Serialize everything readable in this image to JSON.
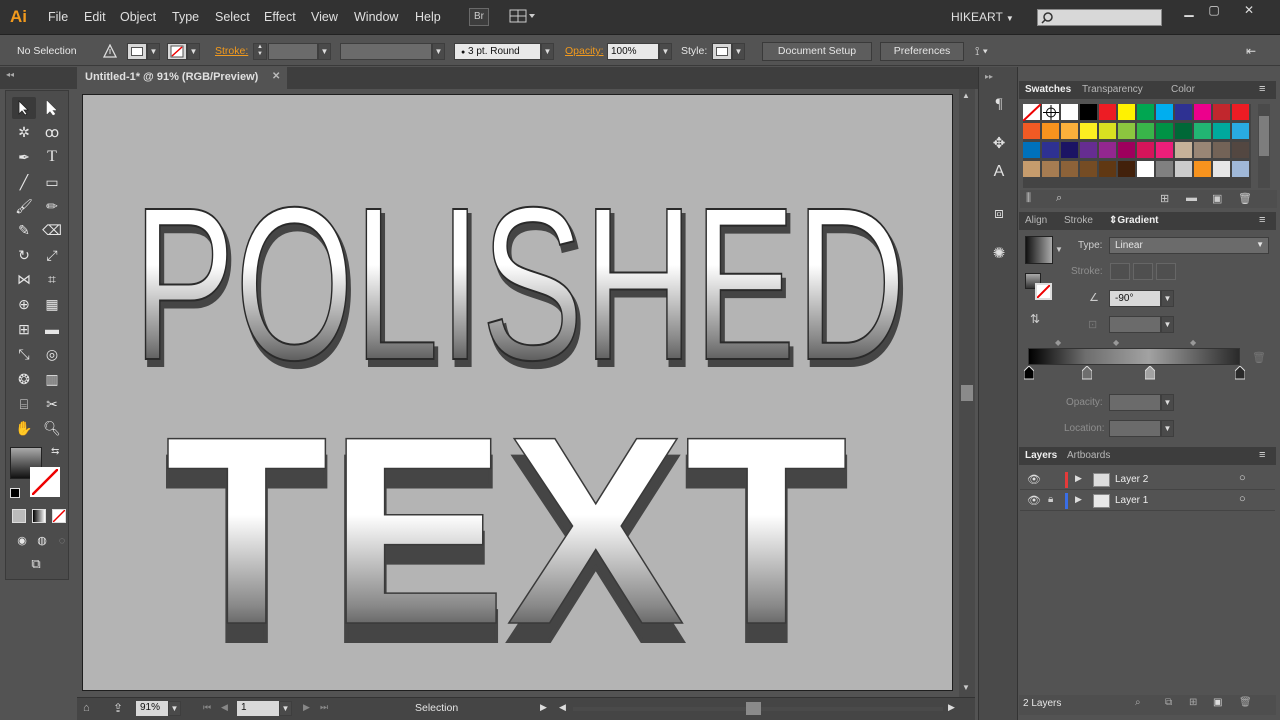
{
  "app": {
    "logo": "Ai",
    "workspace": "HIKEART",
    "bridge_label": "Br"
  },
  "menu": [
    "File",
    "Edit",
    "Object",
    "Type",
    "Select",
    "Effect",
    "View",
    "Window",
    "Help"
  ],
  "control_bar": {
    "selection_status": "No Selection",
    "stroke_label": "Stroke:",
    "brush_value": "3 pt. Round",
    "opacity_label": "Opacity:",
    "opacity_value": "100%",
    "style_label": "Style:",
    "document_setup": "Document Setup",
    "preferences": "Preferences"
  },
  "document": {
    "tab_title": "Untitled-1* @ 91% (RGB/Preview)"
  },
  "artwork": {
    "line1": "POLISHED",
    "line2": "TEXT"
  },
  "status_bar": {
    "zoom": "91%",
    "artboard_number": "1",
    "tool": "Selection"
  },
  "swatches_panel": {
    "tabs": [
      "Swatches",
      "Transparency",
      "Color"
    ],
    "rows": [
      [
        "none",
        "registration",
        "#ffffff",
        "#000000",
        "#ed1c24",
        "#fff200",
        "#00a651",
        "#00aeef",
        "#2e3192",
        "#ec008c",
        "#c1272d",
        "#ed1c24"
      ],
      [
        "#f15a24",
        "#f7931e",
        "#fbb03b",
        "#fcee21",
        "#d9e021",
        "#8cc63f",
        "#39b54a",
        "#009245",
        "#006837",
        "#22b573",
        "#00a99d",
        "#29abe2"
      ],
      [
        "#0071bc",
        "#2e3192",
        "#1b1464",
        "#662d91",
        "#93278f",
        "#9e005d",
        "#d4145a",
        "#ed1e79",
        "#c7b299",
        "#998675",
        "#736357",
        "#534741"
      ],
      [
        "#c69c6d",
        "#a67c52",
        "#8c6239",
        "#754c24",
        "#603813",
        "#42210b",
        "#ffffff",
        "#808080",
        "#cccccc",
        "#f7931e",
        "#e6e6e6",
        "#a0b8d8"
      ]
    ]
  },
  "gradient_panel": {
    "tabs": [
      "Align",
      "Stroke",
      "Gradient"
    ],
    "type_label": "Type:",
    "type_value": "Linear",
    "stroke_label": "Stroke:",
    "angle_value": "-90°",
    "opacity_label": "Opacity:",
    "location_label": "Location:"
  },
  "layers_panel": {
    "tabs": [
      "Layers",
      "Artboards"
    ],
    "layers": [
      {
        "name": "Layer 2",
        "color": "#e53a3a"
      },
      {
        "name": "Layer 1",
        "color": "#3a6ee5"
      }
    ],
    "footer": "2 Layers"
  },
  "colors": {
    "accent": "#f29a1d",
    "artboard": "#b4b4b4"
  }
}
